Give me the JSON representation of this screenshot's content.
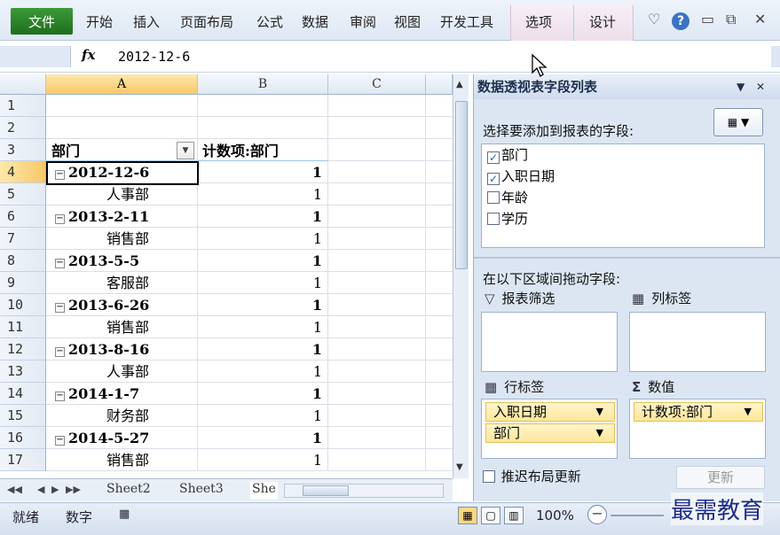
{
  "ribbon": {
    "file": "文件",
    "tabs": [
      "开始",
      "插入",
      "页面布局",
      "公式",
      "数据",
      "审阅",
      "视图",
      "开发工具",
      "选项",
      "设计"
    ]
  },
  "formula_bar": {
    "fx": "fx",
    "value": "2012-12-6"
  },
  "columns": [
    "A",
    "B",
    "C"
  ],
  "rows": [
    "1",
    "2",
    "3",
    "4",
    "5",
    "6",
    "7",
    "8",
    "9",
    "10",
    "11",
    "12",
    "13",
    "14",
    "15",
    "16",
    "17"
  ],
  "pivot": {
    "header_a": "部门",
    "header_b": "计数项:部门",
    "items": [
      {
        "label": "2012-12-6",
        "value": "1",
        "group": true
      },
      {
        "label": "人事部",
        "value": "1",
        "group": false
      },
      {
        "label": "2013-2-11",
        "value": "1",
        "group": true
      },
      {
        "label": "销售部",
        "value": "1",
        "group": false
      },
      {
        "label": "2013-5-5",
        "value": "1",
        "group": true
      },
      {
        "label": "客服部",
        "value": "1",
        "group": false
      },
      {
        "label": "2013-6-26",
        "value": "1",
        "group": true
      },
      {
        "label": "销售部",
        "value": "1",
        "group": false
      },
      {
        "label": "2013-8-16",
        "value": "1",
        "group": true
      },
      {
        "label": "人事部",
        "value": "1",
        "group": false
      },
      {
        "label": "2014-1-7",
        "value": "1",
        "group": true
      },
      {
        "label": "财务部",
        "value": "1",
        "group": false
      },
      {
        "label": "2014-5-27",
        "value": "1",
        "group": true
      },
      {
        "label": "销售部",
        "value": "1",
        "group": false
      }
    ]
  },
  "sheet_tabs": [
    "Sheet2",
    "Sheet3",
    "She"
  ],
  "status": {
    "ready": "就绪",
    "num": "数字",
    "zoom": "100%"
  },
  "field_list": {
    "title": "数据透视表字段列表",
    "choose_label": "选择要添加到报表的字段:",
    "fields": [
      {
        "name": "部门",
        "checked": true
      },
      {
        "name": "入职日期",
        "checked": true
      },
      {
        "name": "年龄",
        "checked": false
      },
      {
        "name": "学历",
        "checked": false
      }
    ],
    "drag_label": "在以下区域间拖动字段:",
    "filter_label": "报表筛选",
    "column_label": "列标签",
    "row_label": "行标签",
    "values_label": "数值",
    "row_fields": [
      "入职日期",
      "部门"
    ],
    "value_fields": [
      "计数项:部门"
    ],
    "defer_label": "推迟布局更新",
    "update_label": "更新"
  },
  "watermark": "最需教育",
  "icons": [
    "minus-icon",
    "help-icon",
    "filter-icon",
    "column-grid-icon",
    "row-grid-icon",
    "sigma-icon",
    "cursor-icon"
  ]
}
